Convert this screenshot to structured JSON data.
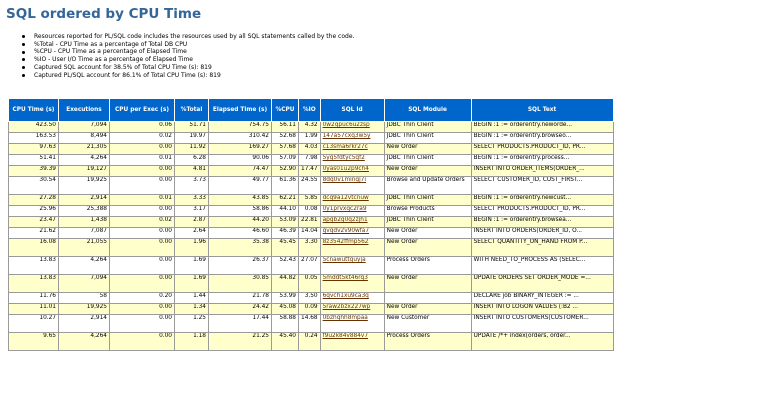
{
  "title": "SQL ordered by CPU Time",
  "notes": [
    "Resources reported for PL/SQL code includes the resources used by all SQL statements called by the code.",
    "%Total - CPU Time as a percentage of Total DB CPU",
    "%CPU - CPU Time as a percentage of Elapsed Time",
    "%IO - User I/O Time as a percentage of Elapsed Time",
    "Captured SQL account for 38.5% of Total CPU Time (s): 819",
    "Captured PL/SQL account for 86.1% of Total CPU Time (s): 819"
  ],
  "table": {
    "headers": [
      "CPU Time (s)",
      "Executions",
      "CPU per Exec (s)",
      "%Total",
      "Elapsed Time (s)",
      "%CPU",
      "%IO",
      "SQL Id",
      "SQL Module",
      "SQL Text"
    ],
    "rows": [
      {
        "cpu": "423.50",
        "execs": "7,094",
        "cpe": "0.06",
        "total": "51.71",
        "elapsed": "754.75",
        "pcpu": "56.11",
        "pio": "4.32",
        "sqlid": "0w2qpuc6u2zsp",
        "module": "JDBC Thin Client",
        "text": "BEGIN :1 := orderentry.neworde..."
      },
      {
        "cpu": "163.53",
        "execs": "8,494",
        "cpe": "0.02",
        "total": "19.97",
        "elapsed": "310.42",
        "pcpu": "52.68",
        "pio": "1.99",
        "sqlid": "147a57cxq3w5y",
        "module": "JDBC Thin Client",
        "text": "BEGIN :1 := orderentry.browseo..."
      },
      {
        "cpu": "97.63",
        "execs": "21,305",
        "cpe": "0.00",
        "total": "11.92",
        "elapsed": "169.27",
        "pcpu": "57.68",
        "pio": "4.03",
        "sqlid": "c13sma6rkr27c",
        "module": "New Order",
        "text": "SELECT PRODUCTS.PRODUCT_ID, PR..."
      },
      {
        "cpu": "51.41",
        "execs": "4,264",
        "cpe": "0.01",
        "total": "6.28",
        "elapsed": "90.06",
        "pcpu": "57.09",
        "pio": "7.98",
        "sqlid": "5yg5fdtyc5gf2",
        "module": "JDBC Thin Client",
        "text": "BEGIN :1 := orderentry.process..."
      },
      {
        "cpu": "39.39",
        "execs": "19,127",
        "cpe": "0.00",
        "total": "4.81",
        "elapsed": "74.47",
        "pcpu": "52.90",
        "pio": "17.47",
        "sqlid": "0yas01u2p9ch4",
        "module": "New Order",
        "text": "INSERT INTO ORDER_ITEMS(ORDER_..."
      },
      {
        "cpu": "30.54",
        "execs": "19,925",
        "cpe": "0.00",
        "total": "3.73",
        "elapsed": "49.77",
        "pcpu": "61.36",
        "pio": "24.55",
        "sqlid": "8dq0v1mingj7i",
        "module": "Browse and Update Orders",
        "text": "SELECT CUSTOMER_ID, CUST_FIRST..."
      },
      {
        "cpu": "27.28",
        "execs": "2,914",
        "cpe": "0.01",
        "total": "3.33",
        "elapsed": "43.85",
        "pcpu": "62.21",
        "pio": "5.85",
        "sqlid": "dcq9a12vtcnuw",
        "module": "JDBC Thin Client",
        "text": "BEGIN :1 := orderentry.newcust..."
      },
      {
        "cpu": "25.96",
        "execs": "25,388",
        "cpe": "0.00",
        "total": "3.17",
        "elapsed": "58.86",
        "pcpu": "44.10",
        "pio": "0.08",
        "sqlid": "0y1prvxqc2ra9",
        "module": "Browse Products",
        "text": "SELECT PRODUCTS.PRODUCT_ID, PR..."
      },
      {
        "cpu": "23.47",
        "execs": "1,438",
        "cpe": "0.02",
        "total": "2.87",
        "elapsed": "44.20",
        "pcpu": "53.09",
        "pio": "22.81",
        "sqlid": "apgb2g0q2zjh1",
        "module": "JDBC Thin Client",
        "text": "BEGIN :1 := orderentry.browsea..."
      },
      {
        "cpu": "21.62",
        "execs": "7,087",
        "cpe": "0.00",
        "total": "2.64",
        "elapsed": "46.60",
        "pcpu": "46.39",
        "pio": "14.04",
        "sqlid": "gvqdv2v90wfa7",
        "module": "New Order",
        "text": "INSERT INTO ORDERS(ORDER_ID, O..."
      },
      {
        "cpu": "16.08",
        "execs": "21,055",
        "cpe": "0.00",
        "total": "1.96",
        "elapsed": "35.38",
        "pcpu": "45.45",
        "pio": "3.30",
        "sqlid": "8z3542ffmp562",
        "module": "New Order",
        "text": "SELECT QUANTITY_ON_HAND FROM P..."
      },
      {
        "cpu": "13.83",
        "execs": "4,264",
        "cpe": "0.00",
        "total": "1.69",
        "elapsed": "26.37",
        "pcpu": "52.43",
        "pio": "27.07",
        "sqlid": "5cnawuttguyja",
        "module": "Process Orders",
        "text": "WITH NEED_TO_PROCESS AS (SELEC..."
      },
      {
        "cpu": "13.83",
        "execs": "7,094",
        "cpe": "0.00",
        "total": "1.69",
        "elapsed": "30.85",
        "pcpu": "44.82",
        "pio": "0.05",
        "sqlid": "5mddt5kt46rq3",
        "module": "New Order",
        "text": "UPDATE ORDERS SET ORDER_MODE =..."
      },
      {
        "cpu": "11.76",
        "execs": "58",
        "cpe": "0.20",
        "total": "1.44",
        "elapsed": "21.78",
        "pcpu": "53.99",
        "pio": "3.50",
        "sqlid": "6qvch1xu9ca3q",
        "module": "",
        "text": "DECLARE job BINARY_INTEGER := ..."
      },
      {
        "cpu": "11.01",
        "execs": "19,925",
        "cpe": "0.00",
        "total": "1.34",
        "elapsed": "24.42",
        "pcpu": "45.08",
        "pio": "0.09",
        "sqlid": "5raw2bzx227wp",
        "module": "New Order",
        "text": "INSERT INTO LOGON VALUES (:B2 ..."
      },
      {
        "cpu": "10.27",
        "execs": "2,914",
        "cpe": "0.00",
        "total": "1.25",
        "elapsed": "17.44",
        "pcpu": "58.88",
        "pio": "14.68",
        "sqlid": "0bzhqhh8mpaa",
        "module": "New Customer",
        "text": "INSERT INTO CUSTOMERS(CUSTOMER..."
      },
      {
        "cpu": "9.65",
        "execs": "4,264",
        "cpe": "0.00",
        "total": "1.18",
        "elapsed": "21.25",
        "pcpu": "45.40",
        "pio": "0.24",
        "sqlid": "f9u2k84v884v7",
        "module": "Process Orders",
        "text": "UPDATE /*+ index(orders, order..."
      }
    ]
  }
}
